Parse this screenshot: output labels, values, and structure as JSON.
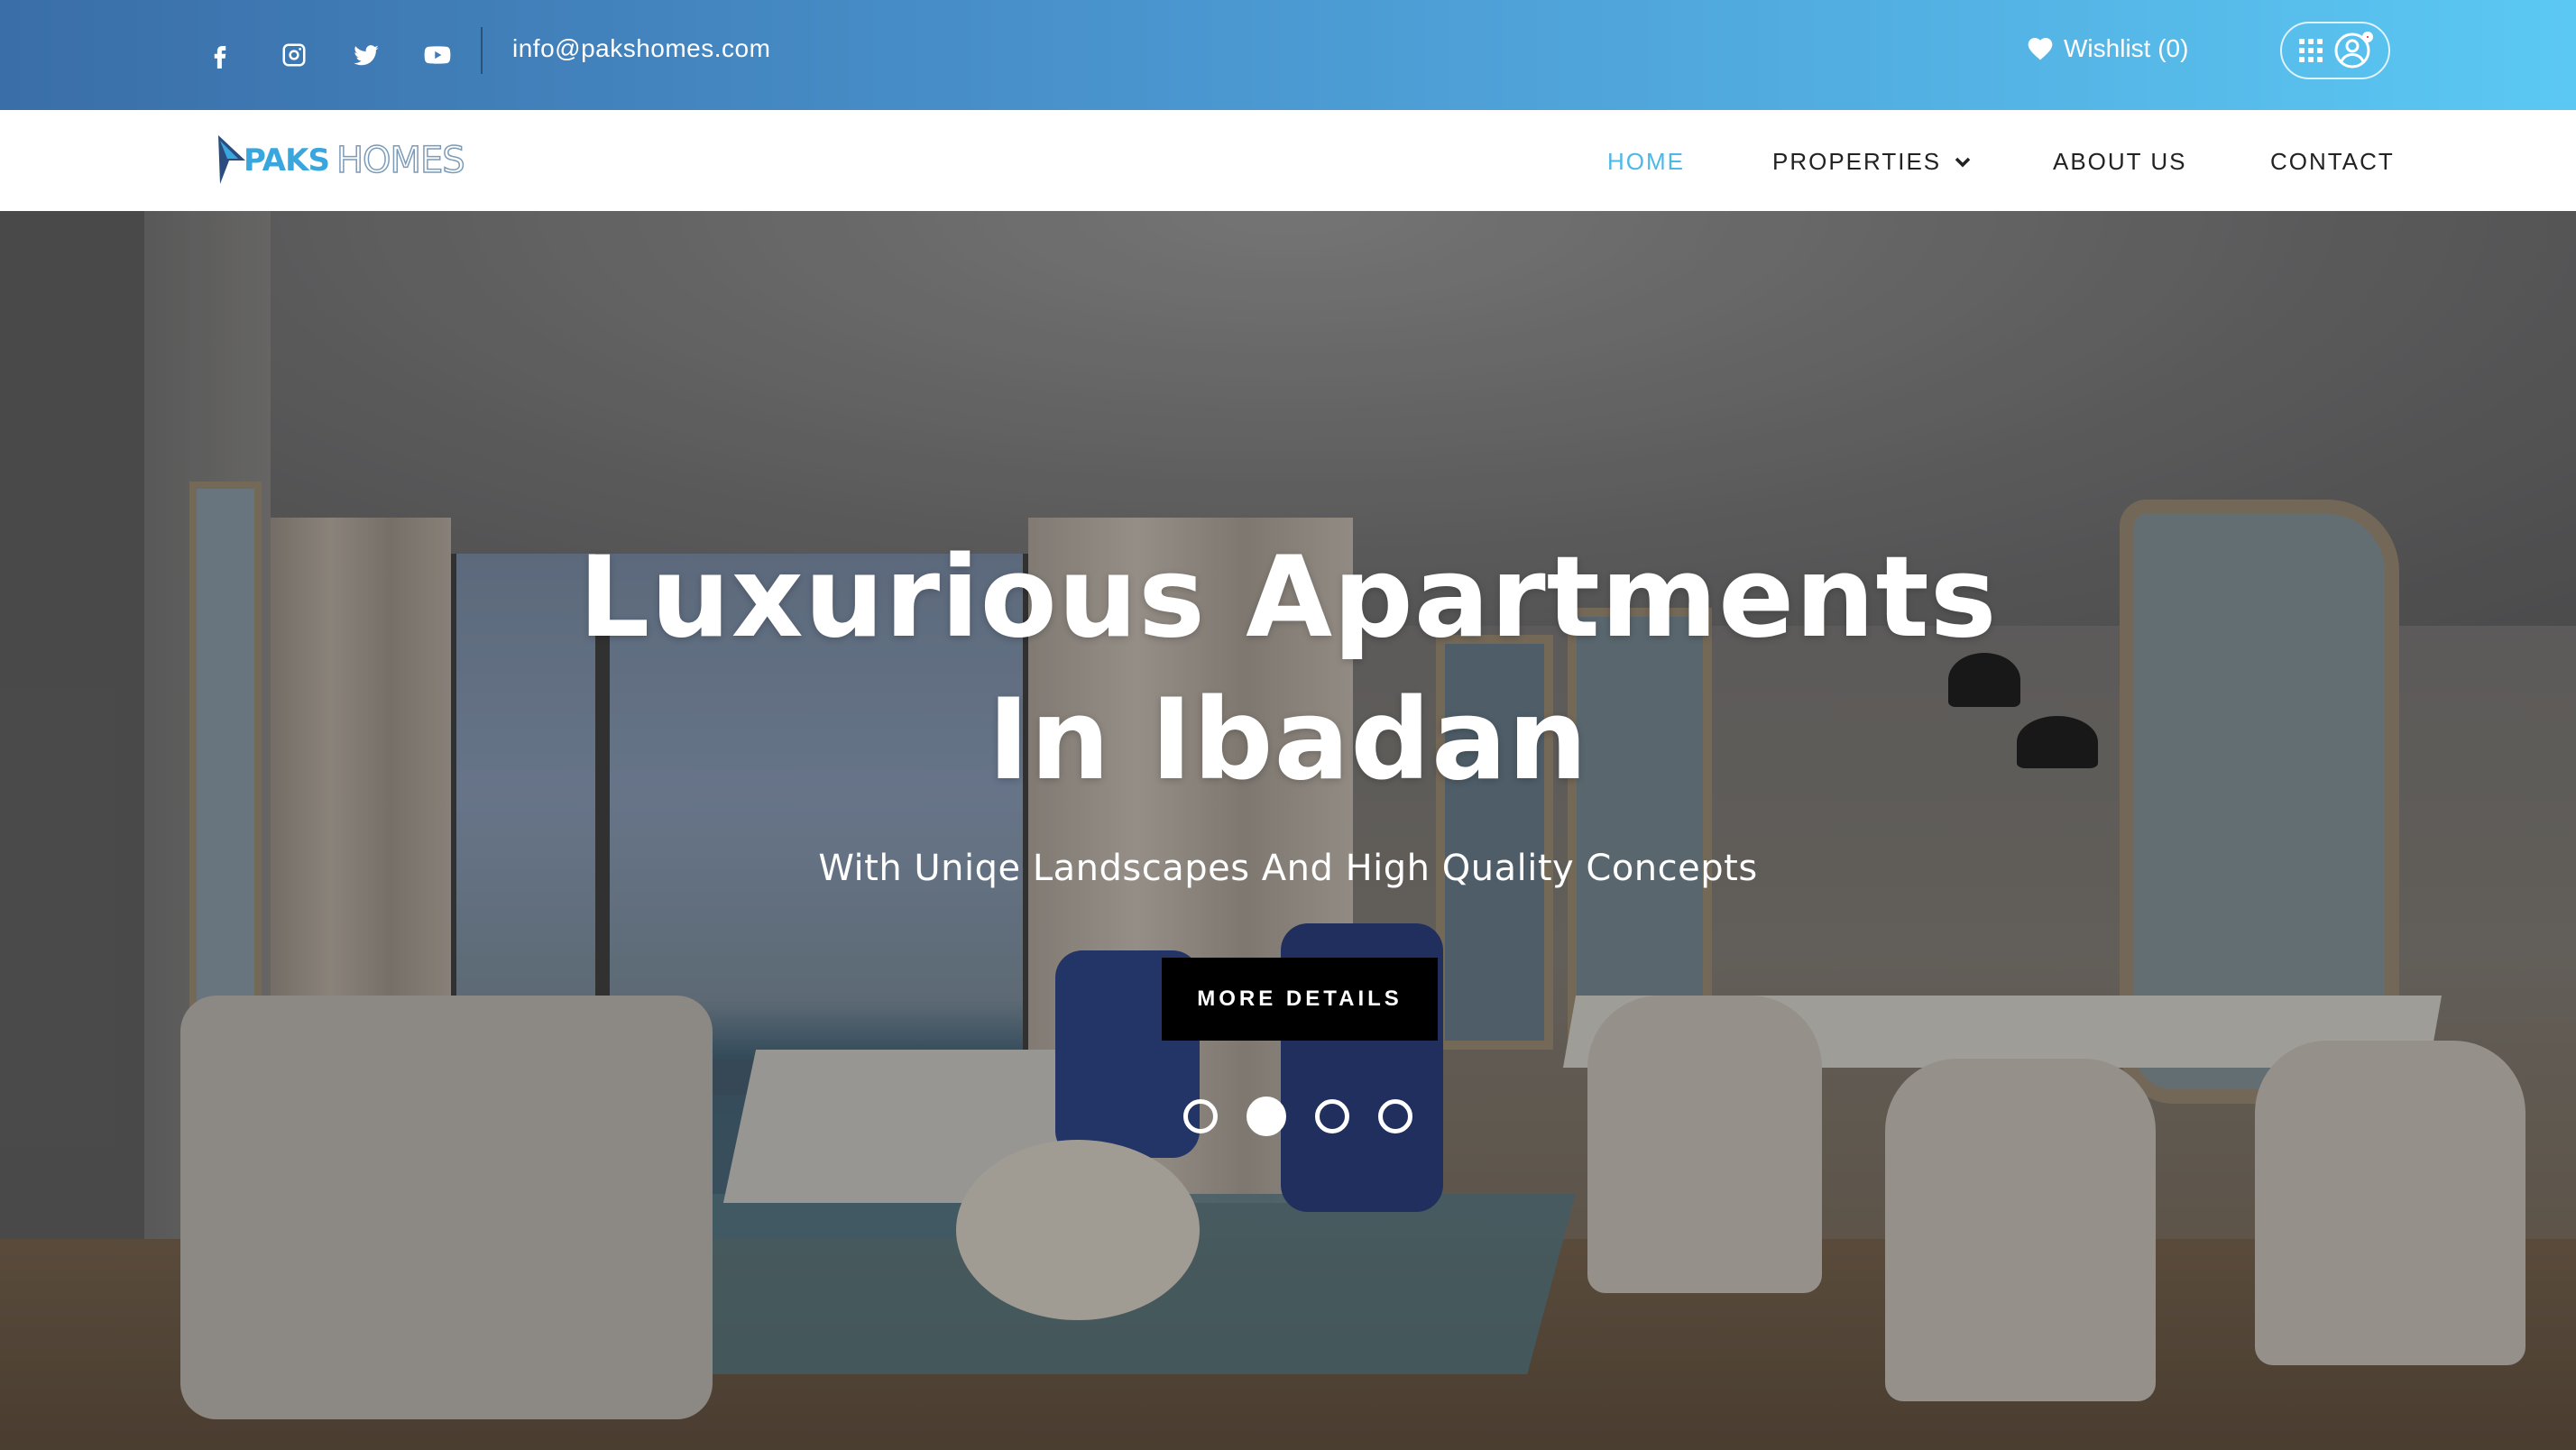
{
  "topbar": {
    "social_icons": [
      "facebook-icon",
      "instagram-icon",
      "twitter-icon",
      "youtube-icon"
    ],
    "email": "info@pakshomes.com",
    "wishlist_label": "Wishlist (0)"
  },
  "nav": {
    "logo_part1": "PAKS",
    "logo_part2": "HOMES",
    "items": [
      {
        "label": "HOME",
        "active": true
      },
      {
        "label": "PROPERTIES",
        "has_dropdown": true
      },
      {
        "label": "ABOUT US"
      },
      {
        "label": "CONTACT"
      }
    ]
  },
  "hero": {
    "title_line1": "Luxurious Apartments",
    "title_line2": "In Ibadan",
    "subtitle": "With Uniqe Landscapes And High Quality Concepts",
    "button_label": "MORE DETAILS",
    "slides_total": 4,
    "active_slide": 2
  },
  "colors": {
    "topbar_start": "#3a6ea8",
    "topbar_end": "#5bc8f3",
    "nav_active": "#4db8e8",
    "nav_text": "#222222",
    "button_bg": "#000000",
    "notification_dot": "#d4202a"
  }
}
